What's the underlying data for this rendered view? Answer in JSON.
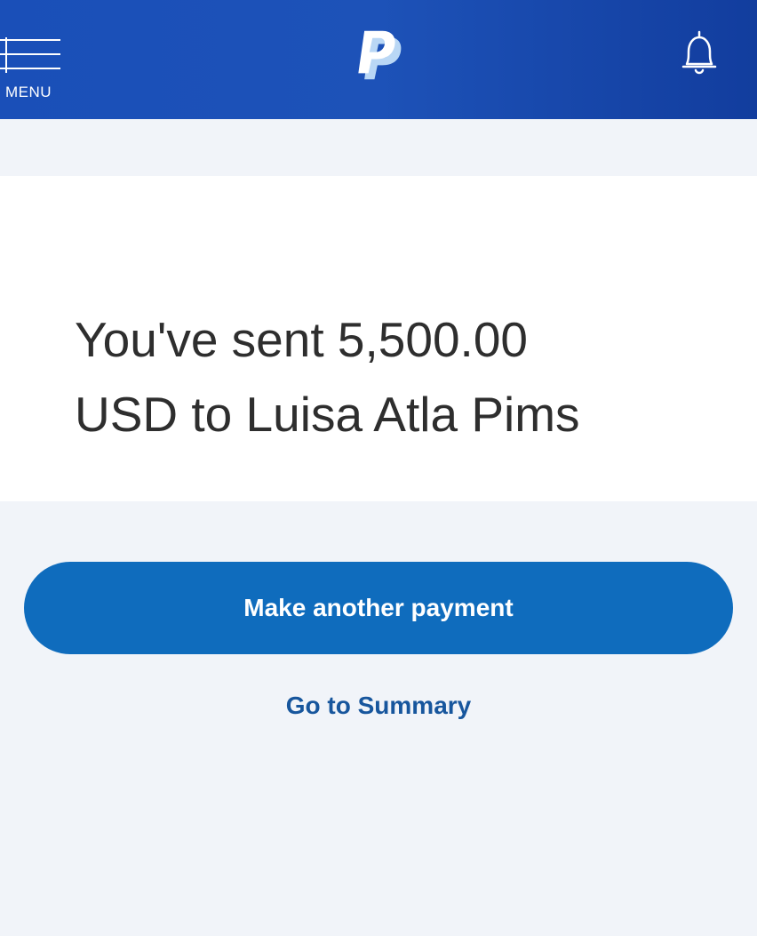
{
  "header": {
    "menu_label": "MENU",
    "menu_icon": "hamburger-icon",
    "logo_icon": "paypal-logo",
    "notification_icon": "bell-icon",
    "background_color": "#1a4fb8"
  },
  "confirmation": {
    "line1": "You've sent 5,500.00",
    "line2": "USD to Luisa Atla Pims"
  },
  "actions": {
    "primary_label": "Make another payment",
    "primary_color": "#0f6cbd",
    "secondary_label": "Go to Summary",
    "secondary_color": "#17569d"
  }
}
